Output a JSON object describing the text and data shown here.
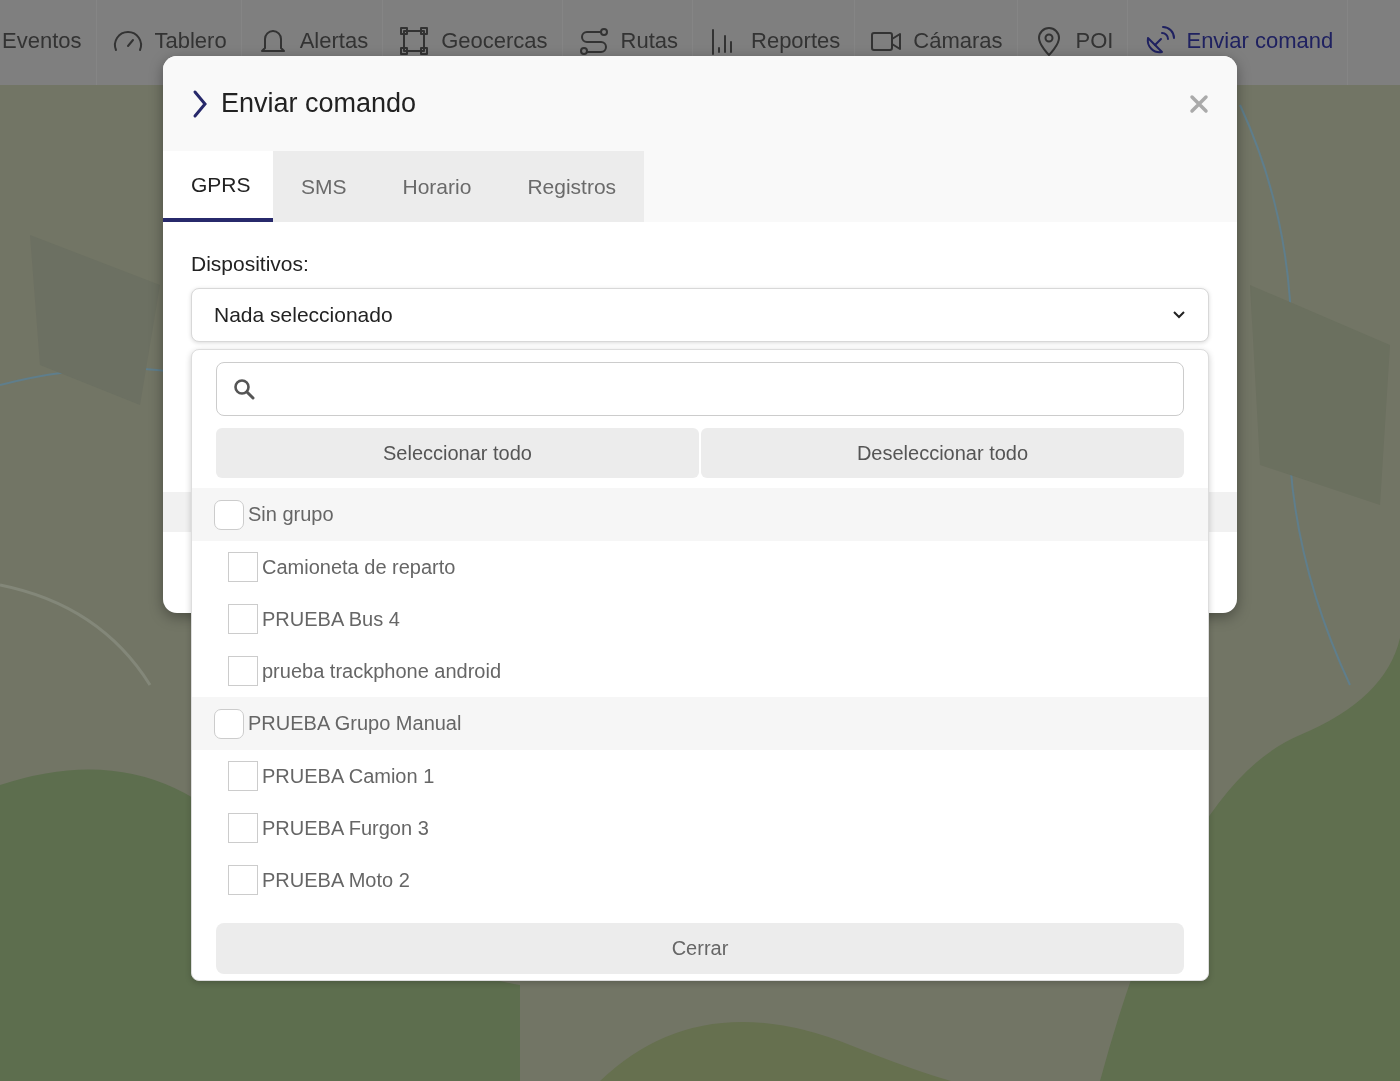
{
  "nav": {
    "items": [
      {
        "label": "Eventos",
        "selected": false
      },
      {
        "label": "Tablero",
        "selected": false
      },
      {
        "label": "Alertas",
        "selected": false
      },
      {
        "label": "Geocercas",
        "selected": false
      },
      {
        "label": "Rutas",
        "selected": false
      },
      {
        "label": "Reportes",
        "selected": false
      },
      {
        "label": "Cámaras",
        "selected": false
      },
      {
        "label": "POI",
        "selected": false
      },
      {
        "label": "Enviar comand",
        "selected": true
      }
    ]
  },
  "dialog": {
    "title": "Enviar comando",
    "tabs": [
      {
        "label": "GPRS",
        "selected": true
      },
      {
        "label": "SMS",
        "selected": false
      },
      {
        "label": "Horario",
        "selected": false
      },
      {
        "label": "Registros",
        "selected": false
      }
    ],
    "devices_label": "Dispositivos:",
    "devices_select": {
      "value": "Nada seleccionado",
      "expanded": true
    },
    "dropdown": {
      "actions": [
        "Seleccionar todo",
        "Deseleccionar todo"
      ],
      "groups": [
        {
          "label": "Sin grupo",
          "checked": false,
          "children": [
            {
              "label": "Camioneta de reparto",
              "checked": false
            },
            {
              "label": "PRUEBA Bus 4",
              "checked": false
            },
            {
              "label": "prueba trackphone android",
              "checked": false
            }
          ]
        },
        {
          "label": "PRUEBA Grupo Manual",
          "checked": false,
          "children": [
            {
              "label": "PRUEBA Camion 1",
              "checked": false
            },
            {
              "label": "PRUEBA Furgon 3",
              "checked": false
            },
            {
              "label": "PRUEBA Moto 2",
              "checked": false
            }
          ]
        }
      ],
      "close_button": "Cerrar"
    }
  }
}
